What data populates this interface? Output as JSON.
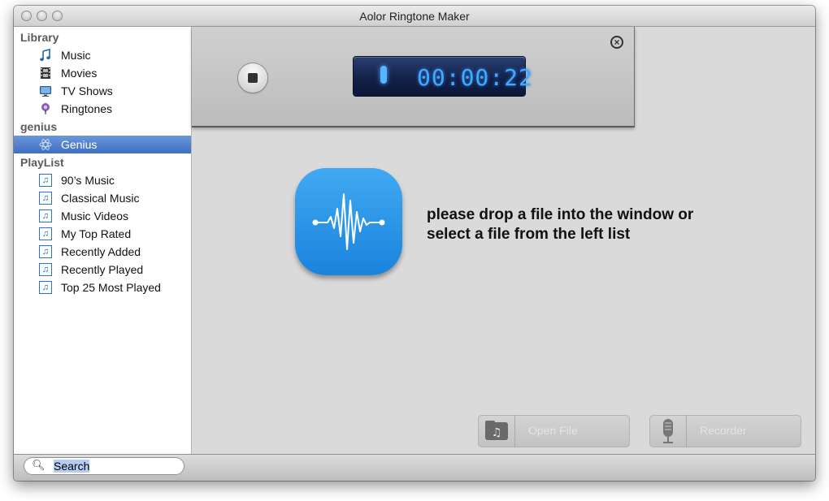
{
  "window": {
    "title": "Aolor Ringtone Maker"
  },
  "sidebar": {
    "groups": [
      {
        "label": "Library"
      },
      {
        "label": "genius"
      },
      {
        "label": "PlayList"
      }
    ],
    "library_items": [
      {
        "label": "Music",
        "icon": "music-note-icon"
      },
      {
        "label": "Movies",
        "icon": "film-icon"
      },
      {
        "label": "TV Shows",
        "icon": "tv-icon"
      },
      {
        "label": "Ringtones",
        "icon": "ringtone-bell-icon"
      }
    ],
    "genius_items": [
      {
        "label": "Genius",
        "icon": "genius-atom-icon",
        "selected": true
      }
    ],
    "playlist_items": [
      {
        "label": "90’s Music"
      },
      {
        "label": "Classical Music"
      },
      {
        "label": "Music Videos"
      },
      {
        "label": "My Top Rated"
      },
      {
        "label": "Recently Added"
      },
      {
        "label": "Recently Played"
      },
      {
        "label": "Top 25 Most Played"
      }
    ]
  },
  "recorder": {
    "time": "00:00:22",
    "lcd_color": "#45a8ff"
  },
  "drop_message": {
    "line1": "please drop a file into the window or",
    "line2": "select a file from the left list"
  },
  "actions": {
    "open_file_label": "Open File",
    "recorder_label": "Recorder"
  },
  "search": {
    "value": "Search"
  },
  "colors": {
    "accent": "#3e6fc4",
    "app_icon": "#2a96e8"
  }
}
